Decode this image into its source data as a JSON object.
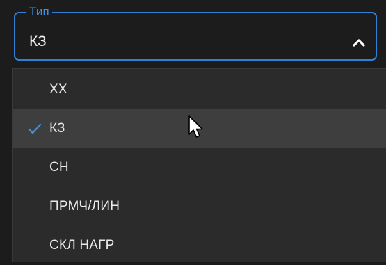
{
  "select": {
    "legend": "Тип",
    "value": "КЗ",
    "accent_color": "#2f80d6",
    "chevron_icon": "chevron-up-icon"
  },
  "dropdown": {
    "options": [
      {
        "label": "ХХ",
        "selected": false
      },
      {
        "label": "КЗ",
        "selected": true
      },
      {
        "label": "СН",
        "selected": false
      },
      {
        "label": "ПРМЧ/ЛИН",
        "selected": false
      },
      {
        "label": "СКЛ НАГР",
        "selected": false
      }
    ],
    "check_icon": "checkmark-icon",
    "check_color": "#3f8fe6"
  },
  "pointer": {
    "icon": "mouse-cursor-icon"
  }
}
